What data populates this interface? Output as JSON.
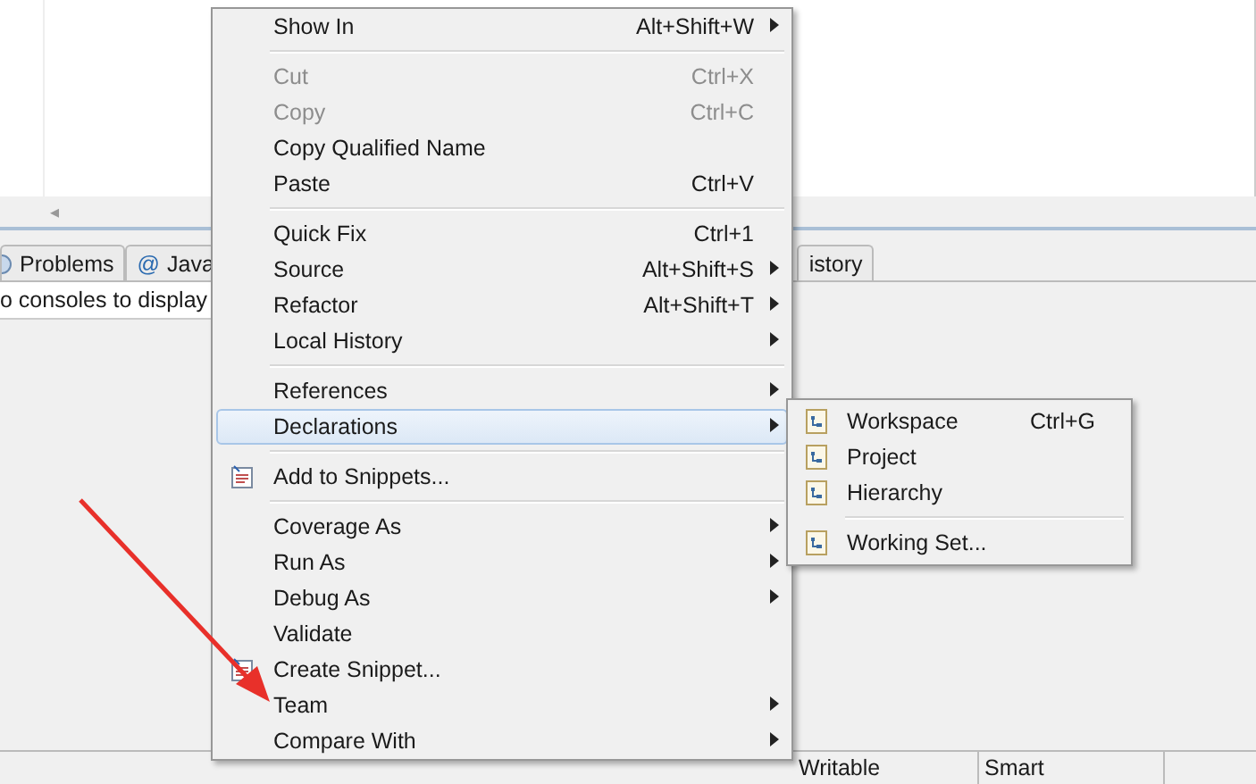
{
  "editor": {
    "scroll_left": "◂"
  },
  "views": {
    "tabs": [
      {
        "label": "Problems",
        "selected": false
      },
      {
        "glyph": "@",
        "label": "Java",
        "selected": false
      },
      {
        "label": "istory",
        "selected": false
      }
    ],
    "console_message": "o consoles to display"
  },
  "context_menu": {
    "items": [
      {
        "kind": "item",
        "label": "Show In",
        "shortcut": "Alt+Shift+W",
        "submenu": true,
        "disabled": false,
        "selected": false,
        "icon": false
      },
      {
        "kind": "separator"
      },
      {
        "kind": "item",
        "label": "Cut",
        "shortcut": "Ctrl+X",
        "submenu": false,
        "disabled": true,
        "selected": false,
        "icon": false
      },
      {
        "kind": "item",
        "label": "Copy",
        "shortcut": "Ctrl+C",
        "submenu": false,
        "disabled": true,
        "selected": false,
        "icon": false
      },
      {
        "kind": "item",
        "label": "Copy Qualified Name",
        "submenu": false,
        "disabled": false,
        "selected": false,
        "icon": false
      },
      {
        "kind": "item",
        "label": "Paste",
        "shortcut": "Ctrl+V",
        "submenu": false,
        "disabled": false,
        "selected": false,
        "icon": false
      },
      {
        "kind": "separator"
      },
      {
        "kind": "item",
        "label": "Quick Fix",
        "shortcut": "Ctrl+1",
        "submenu": false,
        "disabled": false,
        "selected": false,
        "icon": false
      },
      {
        "kind": "item",
        "label": "Source",
        "shortcut": "Alt+Shift+S",
        "submenu": true,
        "disabled": false,
        "selected": false,
        "icon": false
      },
      {
        "kind": "item",
        "label": "Refactor",
        "shortcut": "Alt+Shift+T",
        "submenu": true,
        "disabled": false,
        "selected": false,
        "icon": false
      },
      {
        "kind": "item",
        "label": "Local History",
        "submenu": true,
        "disabled": false,
        "selected": false,
        "icon": false
      },
      {
        "kind": "separator"
      },
      {
        "kind": "item",
        "label": "References",
        "submenu": true,
        "disabled": false,
        "selected": false,
        "icon": false
      },
      {
        "kind": "item",
        "label": "Declarations",
        "submenu": true,
        "disabled": false,
        "selected": true,
        "icon": false
      },
      {
        "kind": "separator"
      },
      {
        "kind": "item",
        "label": "Add to Snippets...",
        "submenu": false,
        "disabled": false,
        "selected": false,
        "icon": true
      },
      {
        "kind": "separator"
      },
      {
        "kind": "item",
        "label": "Coverage As",
        "submenu": true,
        "disabled": false,
        "selected": false,
        "icon": false
      },
      {
        "kind": "item",
        "label": "Run As",
        "submenu": true,
        "disabled": false,
        "selected": false,
        "icon": false
      },
      {
        "kind": "item",
        "label": "Debug As",
        "submenu": true,
        "disabled": false,
        "selected": false,
        "icon": false
      },
      {
        "kind": "item",
        "label": "Validate",
        "submenu": false,
        "disabled": false,
        "selected": false,
        "icon": false
      },
      {
        "kind": "item",
        "label": "Create Snippet...",
        "submenu": false,
        "disabled": false,
        "selected": false,
        "icon": true
      },
      {
        "kind": "item",
        "label": "Team",
        "submenu": true,
        "disabled": false,
        "selected": false,
        "icon": false
      },
      {
        "kind": "item",
        "label": "Compare With",
        "submenu": true,
        "disabled": false,
        "selected": false,
        "icon": false
      }
    ]
  },
  "submenu": {
    "items": [
      {
        "kind": "item",
        "label": "Workspace",
        "shortcut": "Ctrl+G"
      },
      {
        "kind": "item",
        "label": "Project"
      },
      {
        "kind": "item",
        "label": "Hierarchy"
      },
      {
        "kind": "separator"
      },
      {
        "kind": "item",
        "label": "Working Set..."
      }
    ]
  },
  "status_bar": {
    "fields": [
      "Writable",
      "Smart"
    ]
  }
}
